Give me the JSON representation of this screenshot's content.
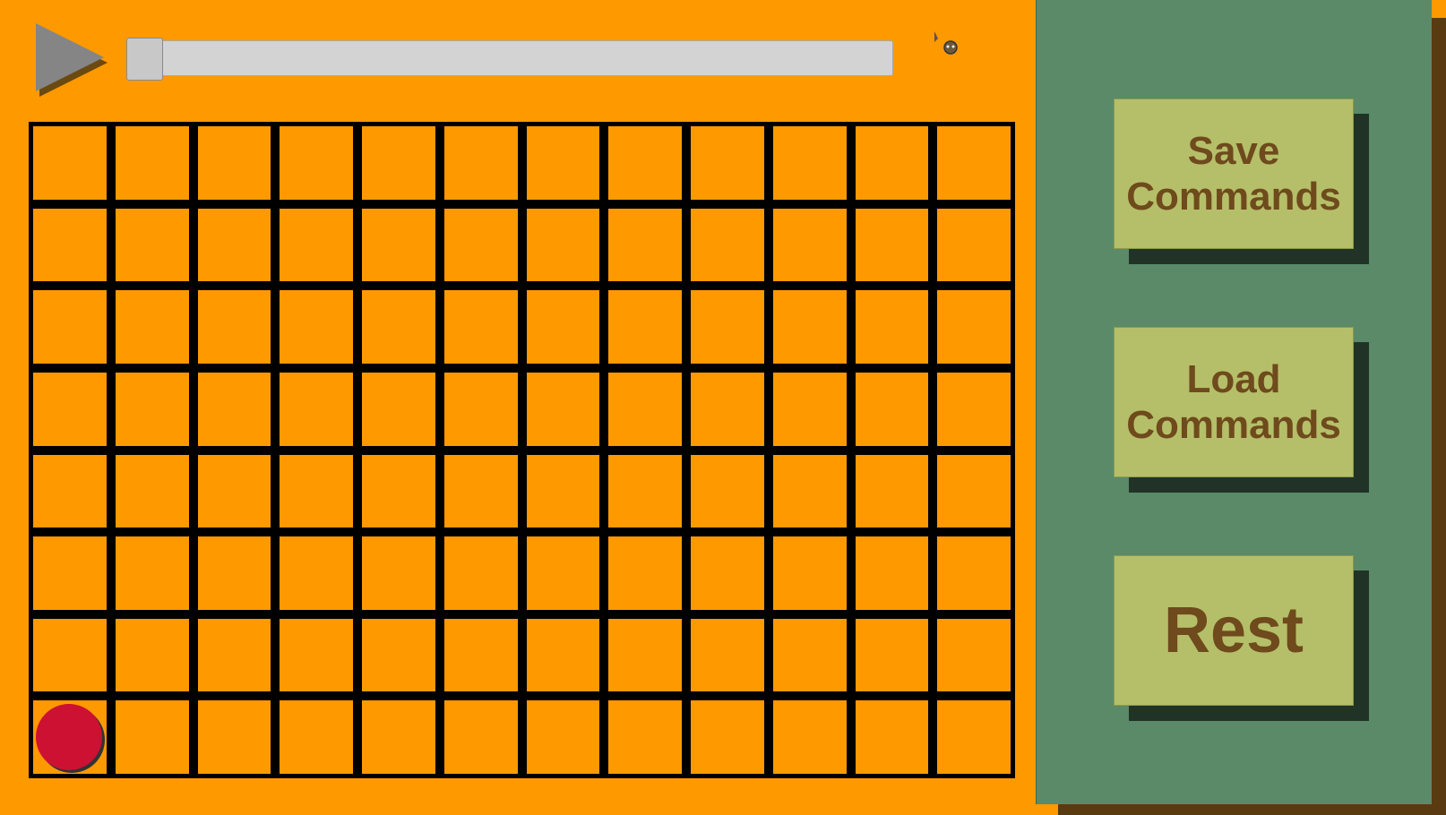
{
  "toolbar": {
    "play_icon": "play-triangle-icon",
    "speed_slider_value": 0,
    "cursor_icon": "mouse-pointer-icon"
  },
  "grid": {
    "columns": 12,
    "rows": 8,
    "cell_color": "#ff9900",
    "line_color": "#000000",
    "robot": {
      "icon": "robot-circle-icon",
      "color": "#cc1133",
      "row": 8,
      "col": 1
    }
  },
  "sidebar": {
    "background_color": "#5a8a67",
    "buttons": [
      {
        "label_line1": "Save",
        "label_line2": "Commands"
      },
      {
        "label_line1": "Load",
        "label_line2": "Commands"
      },
      {
        "label_line1": "Rest",
        "label_line2": ""
      }
    ]
  },
  "colors": {
    "background": "#ff9900",
    "button_face": "#b5bf69",
    "button_text": "#6e4a1c"
  }
}
